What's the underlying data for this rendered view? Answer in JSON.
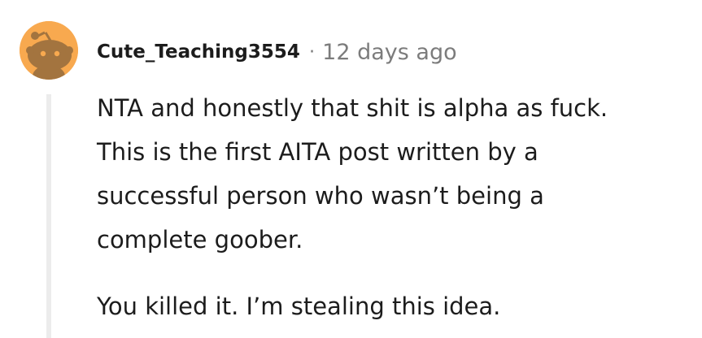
{
  "comment": {
    "author": "Cute_Teaching3554",
    "separator": "·",
    "timestamp": "12 days ago",
    "avatar_icon": "reddit-snoo-avatar-icon",
    "avatar_color": "#f8a94f",
    "body_lines": [
      "NTA and honestly that shit is alpha as fuck.",
      "This is the first AITA post written by a",
      "successful person who wasn’t being a",
      "complete goober."
    ],
    "body_paragraph_2": "You killed it. I’m stealing this idea."
  }
}
